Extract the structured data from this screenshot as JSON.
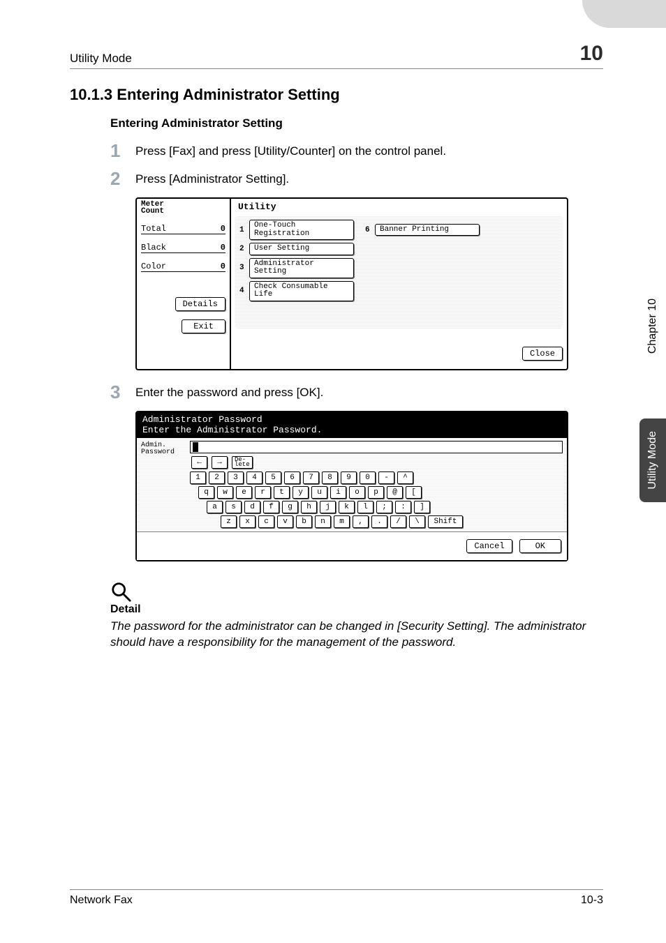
{
  "header": {
    "breadcrumb": "Utility Mode",
    "chapter_number": "10"
  },
  "section": {
    "heading": "10.1.3 Entering Administrator Setting",
    "sub_heading": "Entering Administrator Setting"
  },
  "steps": {
    "s1_num": "1",
    "s1_text": "Press [Fax] and press [Utility/Counter] on the control panel.",
    "s2_num": "2",
    "s2_text": "Press [Administrator Setting].",
    "s3_num": "3",
    "s3_text": "Enter the password and press [OK]."
  },
  "utility_panel": {
    "meter_label_a": "Meter",
    "meter_label_b": "Count",
    "rows": {
      "total_label": "Total",
      "total_val": "0",
      "black_label": "Black",
      "black_val": "0",
      "color_label": "Color",
      "color_val": "0"
    },
    "details_btn": "Details",
    "exit_btn": "Exit",
    "title": "Utility",
    "items": {
      "i1_num": "1",
      "i1_label": "One-Touch\nRegistration",
      "i2_num": "2",
      "i2_label": "User Setting",
      "i3_num": "3",
      "i3_label": "Administrator\nSetting",
      "i4_num": "4",
      "i4_label": "Check Consumable\nLife",
      "i6_num": "6",
      "i6_label": "Banner Printing"
    },
    "close_btn": "Close"
  },
  "kbd_panel": {
    "title_line1": "Administrator Password",
    "title_line2": "Enter the Administrator Password.",
    "left_label": "Admin.\nPassword",
    "arrow_left": "←",
    "arrow_right": "→",
    "delete": "De-\nlete",
    "rows": {
      "r1": [
        "1",
        "2",
        "3",
        "4",
        "5",
        "6",
        "7",
        "8",
        "9",
        "0",
        "-",
        "^"
      ],
      "r2": [
        "q",
        "w",
        "e",
        "r",
        "t",
        "y",
        "u",
        "i",
        "o",
        "p",
        "@",
        "["
      ],
      "r3": [
        "a",
        "s",
        "d",
        "f",
        "g",
        "h",
        "j",
        "k",
        "l",
        ";",
        ":",
        "]"
      ],
      "r4": [
        "z",
        "x",
        "c",
        "v",
        "b",
        "n",
        "m",
        ",",
        ".",
        "/",
        "\\"
      ]
    },
    "shift": "Shift",
    "cancel": "Cancel",
    "ok": "OK"
  },
  "detail": {
    "heading": "Detail",
    "body": "The password for the administrator can be changed in [Security Setting]. The administrator should have a responsibility for the management of the password."
  },
  "side_tab": {
    "upper": "Chapter 10",
    "lower": "Utility Mode"
  },
  "footer": {
    "left": "Network Fax",
    "right": "10-3"
  }
}
